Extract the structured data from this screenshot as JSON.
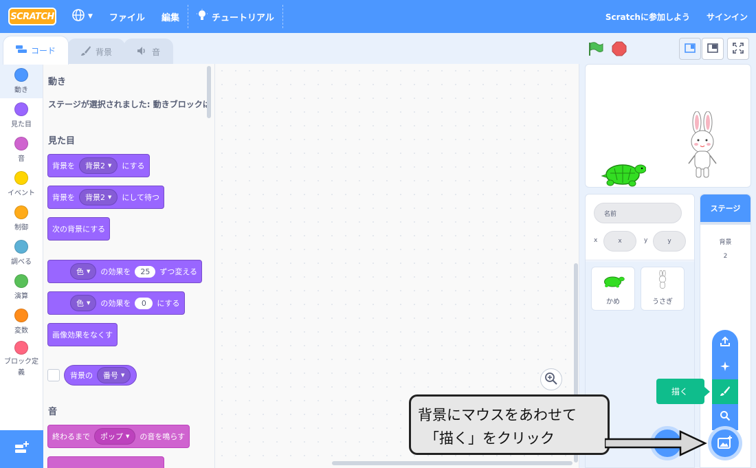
{
  "menubar": {
    "logo": "SCRATCH",
    "file": "ファイル",
    "edit": "編集",
    "tutorials": "チュートリアル",
    "join": "Scratchに参加しよう",
    "signin": "サインイン"
  },
  "tabs": [
    {
      "label": "コード"
    },
    {
      "label": "背景"
    },
    {
      "label": "音"
    }
  ],
  "categories": [
    {
      "label": "動き",
      "color": "#4c97ff"
    },
    {
      "label": "見た目",
      "color": "#9966ff"
    },
    {
      "label": "音",
      "color": "#cf63cf"
    },
    {
      "label": "イベント",
      "color": "#ffd500"
    },
    {
      "label": "制御",
      "color": "#ffab19"
    },
    {
      "label": "調べる",
      "color": "#5cb1d6"
    },
    {
      "label": "演算",
      "color": "#59c059"
    },
    {
      "label": "変数",
      "color": "#ff8c1a"
    },
    {
      "label": "ブロック定義",
      "color": "#ff6680"
    }
  ],
  "palette": {
    "motion_head": "動き",
    "motion_note": "ステージが選択されました: 動きブロックは",
    "looks_head": "見た目",
    "b1_pre": "背景を",
    "b1_dd": "背景2",
    "b1_post": "にする",
    "b2_pre": "背景を",
    "b2_dd": "背景2",
    "b2_post": "にして待つ",
    "b3": "次の背景にする",
    "b4_dd": "色",
    "b4_mid": "の効果を",
    "b4_num": "25",
    "b4_post": "ずつ変える",
    "b5_dd": "色",
    "b5_mid": "の効果を",
    "b5_num": "0",
    "b5_post": "にする",
    "b6": "画像効果をなくす",
    "r1_pre": "背景の",
    "r1_dd": "番号",
    "sound_head": "音",
    "s1_pre": "終わるまで",
    "s1_dd": "ポップ",
    "s1_post": "の音を鳴らす"
  },
  "sprite_info": {
    "name_placeholder": "名前",
    "x_label": "x",
    "x_placeholder": "x",
    "y_label": "y",
    "y_placeholder": "y"
  },
  "sprites": [
    {
      "name": "かめ"
    },
    {
      "name": "うさぎ"
    }
  ],
  "stage_selector": {
    "title": "ステージ",
    "backdrops_label": "背景",
    "backdrops_count": "2"
  },
  "tooltip": "描く",
  "callout": {
    "line1": "背景にマウスをあわせて",
    "line2": "「描く」をクリック"
  }
}
